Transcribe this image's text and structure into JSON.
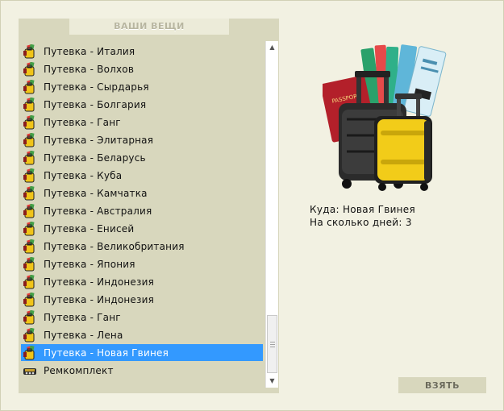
{
  "panel": {
    "title": "ВАШИ ВЕЩИ"
  },
  "items": [
    {
      "label": "Путевка - Италия",
      "icon": "ticket-bag-icon"
    },
    {
      "label": "Путевка - Волхов",
      "icon": "ticket-bag-icon"
    },
    {
      "label": "Путевка - Сырдарья",
      "icon": "ticket-bag-icon"
    },
    {
      "label": "Путевка - Болгария",
      "icon": "ticket-bag-icon"
    },
    {
      "label": "Путевка - Ганг",
      "icon": "ticket-bag-icon"
    },
    {
      "label": "Путевка - Элитарная",
      "icon": "ticket-bag-icon"
    },
    {
      "label": "Путевка - Беларусь",
      "icon": "ticket-bag-icon"
    },
    {
      "label": "Путевка - Куба",
      "icon": "ticket-bag-icon"
    },
    {
      "label": "Путевка - Камчатка",
      "icon": "ticket-bag-icon"
    },
    {
      "label": "Путевка - Австралия",
      "icon": "ticket-bag-icon"
    },
    {
      "label": "Путевка - Енисей",
      "icon": "ticket-bag-icon"
    },
    {
      "label": "Путевка - Великобритания",
      "icon": "ticket-bag-icon"
    },
    {
      "label": "Путевка - Япония",
      "icon": "ticket-bag-icon"
    },
    {
      "label": "Путевка - Индонезия",
      "icon": "ticket-bag-icon"
    },
    {
      "label": "Путевка - Индонезия",
      "icon": "ticket-bag-icon"
    },
    {
      "label": "Путевка - Ганг",
      "icon": "ticket-bag-icon"
    },
    {
      "label": "Путевка - Лена",
      "icon": "ticket-bag-icon"
    },
    {
      "label": "Путевка - Новая Гвинея",
      "icon": "ticket-bag-icon",
      "selected": true
    },
    {
      "label": "Ремкомплект",
      "icon": "repair-kit-icon"
    }
  ],
  "details": {
    "destination_label": "Куда:",
    "destination_value": "Новая Гвинея",
    "days_label": "На сколько дней:",
    "days_value": "3"
  },
  "actions": {
    "take_label": "ВЗЯТЬ"
  },
  "colors": {
    "background": "#f2f1e2",
    "panel": "#d8d7bd",
    "selection": "#3399ff"
  }
}
